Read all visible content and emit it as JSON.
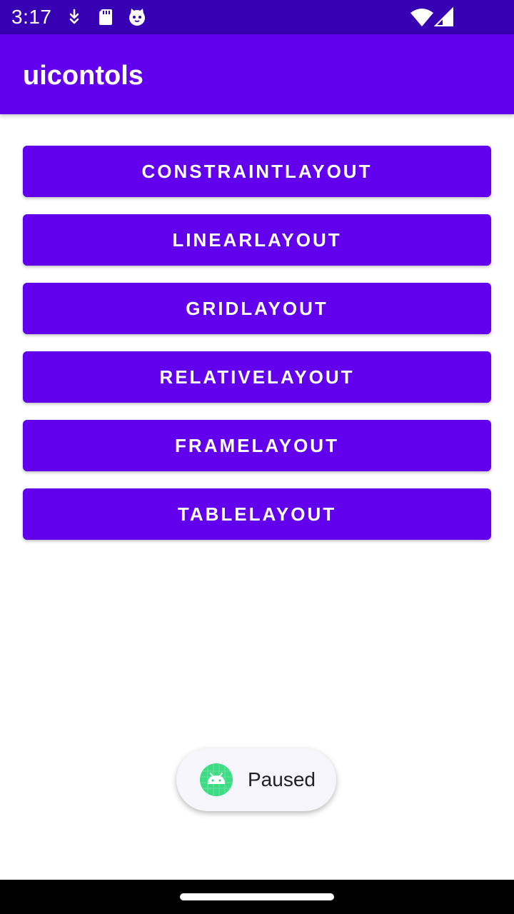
{
  "status_bar": {
    "time": "3:17",
    "icons": [
      "download-icon",
      "sd-card-icon",
      "cat-face-icon",
      "wifi-icon",
      "cell-signal-icon"
    ]
  },
  "app_bar": {
    "title": "uicontols"
  },
  "buttons": [
    {
      "label": "CONSTRAINTLAYOUT"
    },
    {
      "label": "LINEARLAYOUT"
    },
    {
      "label": "GRIDLAYOUT"
    },
    {
      "label": "RELATIVELAYOUT"
    },
    {
      "label": "FRAMELAYOUT"
    },
    {
      "label": "TABLELAYOUT"
    }
  ],
  "toast": {
    "text": "Paused",
    "icon": "android-icon"
  },
  "colors": {
    "status_bar": "#3700b3",
    "primary": "#6200ee",
    "background": "#ffffff",
    "toast_icon": "#3ddc84"
  }
}
